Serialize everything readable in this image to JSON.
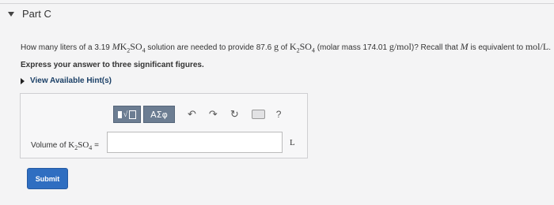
{
  "part": {
    "title": "Part C"
  },
  "question": {
    "text1": "How many liters of a 3.19",
    "molarity_symbol": "M",
    "compound_main": "K",
    "compound_sub1": "2",
    "compound_mid": "SO",
    "compound_sub2": "4",
    "text2": "solution are needed to provide 87.6",
    "gram_unit": "g",
    "text3": "of",
    "text4": "(molar mass 174.01",
    "molar_unit": "g/mol",
    "text5": ")? Recall that",
    "text6": "is equivalent to",
    "equiv_unit": "mol/L",
    "period": "."
  },
  "instruction": "Express your answer to three significant figures.",
  "hints": {
    "label": "View Available Hint(s)"
  },
  "toolbar": {
    "greek_label": "ΑΣφ",
    "undo_glyph": "↶",
    "redo_glyph": "↷",
    "reset_glyph": "↻",
    "help_glyph": "?",
    "icons": [
      "templates-icon",
      "greek-symbols-icon",
      "undo-icon",
      "redo-icon",
      "reset-icon",
      "keyboard-icon",
      "help-icon"
    ]
  },
  "answer": {
    "label_prefix": "Volume of",
    "label_suffix": "=",
    "value": "",
    "unit": "L"
  },
  "submit": {
    "label": "Submit"
  },
  "colors": {
    "submit": "#2f6ec1",
    "toolbar_button": "#6c7d92",
    "hint_link": "#1a3f66"
  }
}
